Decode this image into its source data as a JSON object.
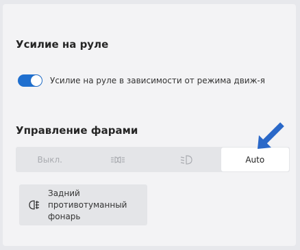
{
  "steering": {
    "title": "Усилие на руле",
    "toggle_label": "Усилие на руле в зависимости от режима движ-я",
    "toggle_on": true
  },
  "headlights": {
    "title": "Управление фарами",
    "options": [
      {
        "label": "Выкл.",
        "icon": null
      },
      {
        "label": "",
        "icon": "parking-lights-icon"
      },
      {
        "label": "",
        "icon": "low-beam-icon"
      },
      {
        "label": "Auto",
        "icon": null
      }
    ],
    "selected": "Auto"
  },
  "fog": {
    "label": "Задний противотуманный фонарь",
    "icon": "rear-fog-light-icon"
  },
  "colors": {
    "accent": "#1f6fcf",
    "arrow": "#2a68c8"
  }
}
